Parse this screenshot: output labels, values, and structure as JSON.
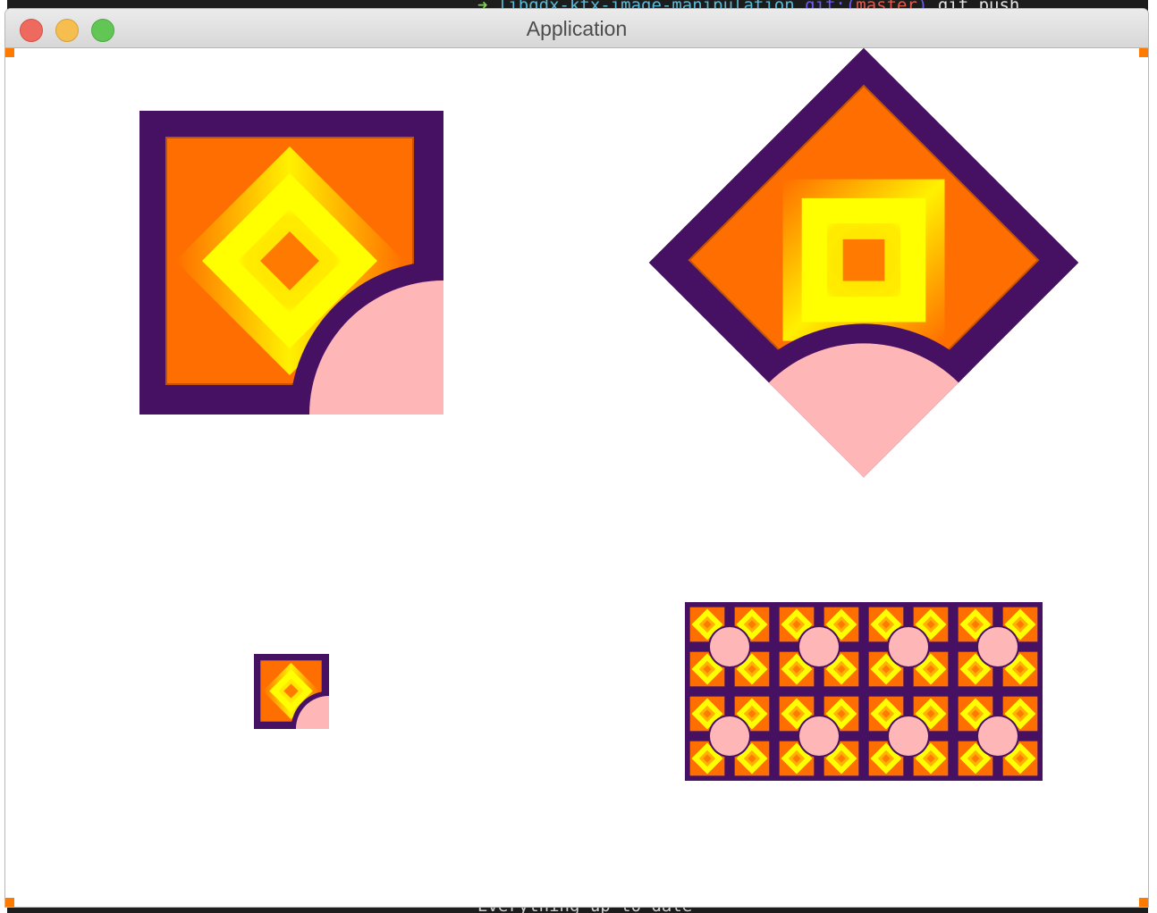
{
  "window": {
    "title": "Application"
  },
  "terminal": {
    "top_arrow": "➜",
    "top_path": "libgdx-ktx-image-manipulation",
    "top_git": "git:(",
    "top_branch": "master",
    "top_git_close": ")",
    "top_cmd": "git push",
    "bottom_text": "Everything up to date"
  },
  "sprite": {
    "outline_color": "#461063",
    "fill_orange": "#ff6e00",
    "fill_yellow": "#ffff00",
    "cutout_pink": "#ffb6b6",
    "icon": "gradient-square-sprite"
  },
  "sprites": [
    {
      "name": "sprite-original"
    },
    {
      "name": "sprite-rotated"
    },
    {
      "name": "sprite-scaled"
    },
    {
      "name": "sprite-tiled"
    }
  ]
}
